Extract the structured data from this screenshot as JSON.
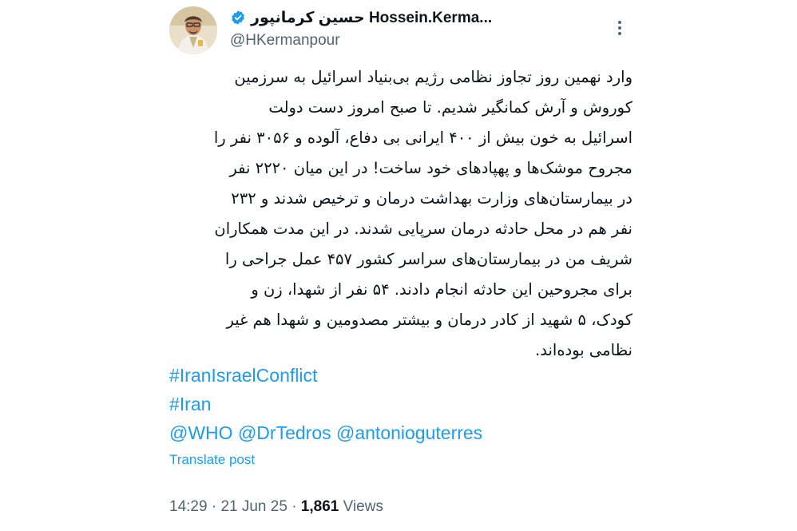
{
  "author": {
    "display_name": "حسین کرمانپور Hossein.Kerma...",
    "handle": "@HKermanpour",
    "verified": true
  },
  "tweet": {
    "lines": [
      "وارد نهمین  روز تجاوز نظامی رژیم بی‌بنیاد اسرائیل به سرزمین",
      "کوروش و آرش کمانگیر شدیم. تا صبح امروز دست دولت",
      "اسرائیل به خون بیش از ۴۰۰ ایرانی بی دفاع، آلوده و ۳۰۵۶ نفر را",
      "مجروح موشک‌ها و پهپادهای خود ساخت! در این میان ۲۲۲۰ نفر",
      "در بیمارستان‌های وزارت بهداشت درمان و ترخیص شدند و ۲۳۲",
      "نفر هم در محل حادثه درمان سرپایی شدند. در این مدت همکاران",
      "شریف من در بیمارستان‌های سراسر کشور ۴۵۷ عمل جراحی را",
      "برای مجروحین این حادثه انجام دادند. ۵۴ نفر از شهدا، زن و",
      "کودک، ۵ شهید از کادر درمان و بیشتر مصدومین و شهدا هم غیر",
      "نظامی بوده‌اند."
    ],
    "hashtags": [
      "#IranIsraelConflict",
      "#Iran"
    ],
    "mentions": [
      "@WHO",
      "@DrTedros",
      "@antonioguterres"
    ],
    "translate_label": "Translate post",
    "time": "14:29",
    "date": "21 Jun 25",
    "separator": "·",
    "views_count": "1,861",
    "views_label": "Views"
  },
  "colors": {
    "link": "#1d9bf0",
    "text": "#0f1419",
    "muted": "#536471",
    "verified": "#1d9bf0"
  },
  "icons": {
    "verified": "verified-badge-icon",
    "more": "more-options-icon"
  }
}
